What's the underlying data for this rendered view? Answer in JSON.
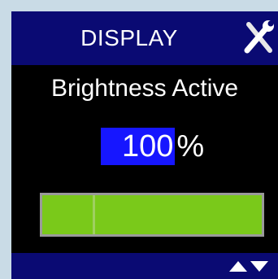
{
  "header": {
    "title": "DISPLAY",
    "icon": "tools-icon"
  },
  "setting": {
    "label": "Brightness Active",
    "value": "100",
    "unit": "%",
    "level_percent": 100
  },
  "footer": {
    "icons": [
      "arrow-up-icon",
      "arrow-down-icon"
    ]
  },
  "colors": {
    "header_bg": "#0a0a73",
    "screen_bg": "#000000",
    "value_highlight": "#1616ff",
    "bar_fill": "#7ac91a",
    "bar_border": "#9a9a9a"
  }
}
